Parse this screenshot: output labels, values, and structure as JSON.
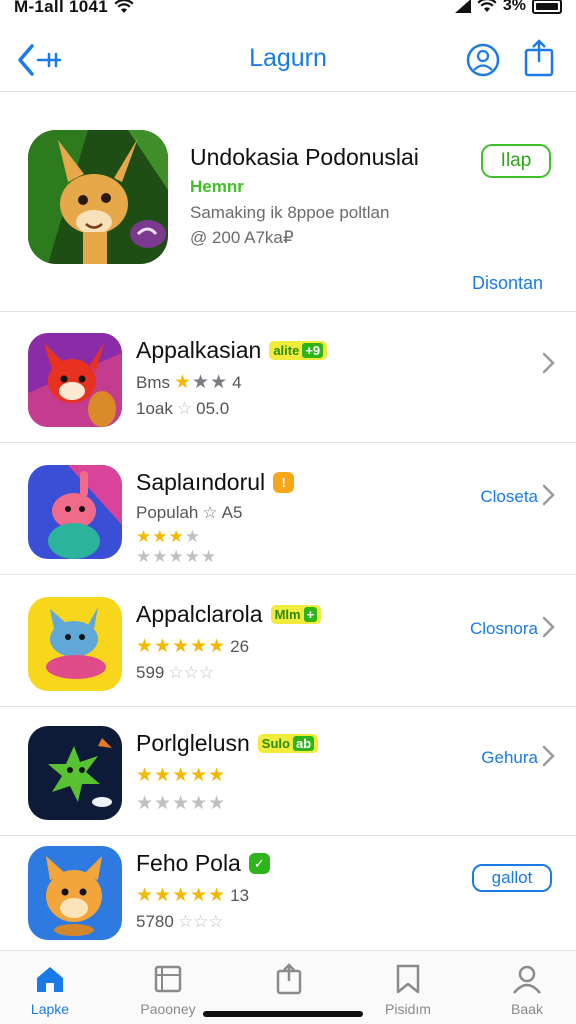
{
  "status": {
    "carrier_time": "M-1all 1041",
    "battery": "3%"
  },
  "nav": {
    "title": "Lagurn",
    "back_icon": "back-arrow-icon",
    "account_icon": "account-icon",
    "share_icon": "share-icon"
  },
  "featured": {
    "title": "Undokasia Podonuslai",
    "tag": "Hemnr",
    "subtitle": "Samaking ik 8ppoe poltlan",
    "meta": "@ 200 A7ka₽",
    "button": "Ilap",
    "link": "Disontan"
  },
  "apps": [
    {
      "title": "Appalkasian",
      "badge": "alite",
      "badge_plus": "+9",
      "line2": "Bms",
      "rating_text": "4",
      "line3": "1oak",
      "line3_value": "05.0",
      "action": ""
    },
    {
      "title": "Saplaındorul",
      "badge_icon": "!",
      "line2": "Populah",
      "rating_text": "A5",
      "action": "Closeta"
    },
    {
      "title": "Appalclarola",
      "badge": "Mlm",
      "badge_plus": "+",
      "rating_text": "26",
      "line3": "599",
      "action": "Closnora"
    },
    {
      "title": "Porlglelusn",
      "badge": "Sulo",
      "badge_plus": "ab",
      "action": "Gehura"
    },
    {
      "title": "Feho Pola",
      "badge_icon": "✓",
      "rating_text": "13",
      "line3": "5780",
      "action": "gallot"
    }
  ],
  "tabs": [
    {
      "label": "Lapke",
      "icon": "home-icon",
      "active": true
    },
    {
      "label": "Paooney",
      "icon": "book-icon",
      "active": false
    },
    {
      "label": "",
      "icon": "share-tab-icon",
      "active": false
    },
    {
      "label": "Pisidım",
      "icon": "bookmark-icon",
      "active": false
    },
    {
      "label": "Baak",
      "icon": "profile-icon",
      "active": false
    }
  ],
  "colors": {
    "accent": "#1a7be8",
    "green": "#3fbf28",
    "star": "#f5b800"
  }
}
